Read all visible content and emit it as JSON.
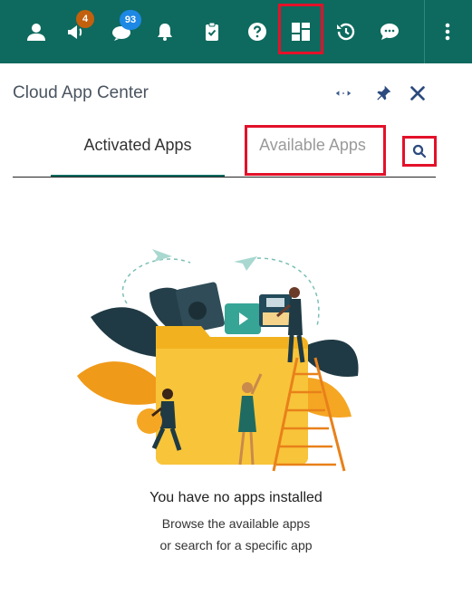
{
  "toolbar": {
    "items": [
      {
        "name": "user-icon"
      },
      {
        "name": "megaphone-icon",
        "badge": "4"
      },
      {
        "name": "chat-notifications-icon",
        "badge": "93"
      },
      {
        "name": "bell-icon"
      },
      {
        "name": "clipboard-icon"
      },
      {
        "name": "help-icon"
      },
      {
        "name": "dashboard-grid-icon"
      },
      {
        "name": "history-icon"
      },
      {
        "name": "messages-icon"
      },
      {
        "name": "more-vertical-icon"
      }
    ],
    "background": "#0e6a5e"
  },
  "panel": {
    "title": "Cloud App Center",
    "actions": [
      "expand-horizontal-icon",
      "pin-icon",
      "close-icon"
    ]
  },
  "tabs": {
    "activated": "Activated Apps",
    "available": "Available Apps"
  },
  "search": {
    "icon": "search-icon"
  },
  "empty_state": {
    "title": "You have no apps installed",
    "line1": "Browse the available apps",
    "line2": "or search for a specific app"
  },
  "colors": {
    "accent": "#0e6a5e",
    "highlight": "#e3112a",
    "badge_orange": "#c2600e",
    "badge_blue": "#1e88e5"
  }
}
